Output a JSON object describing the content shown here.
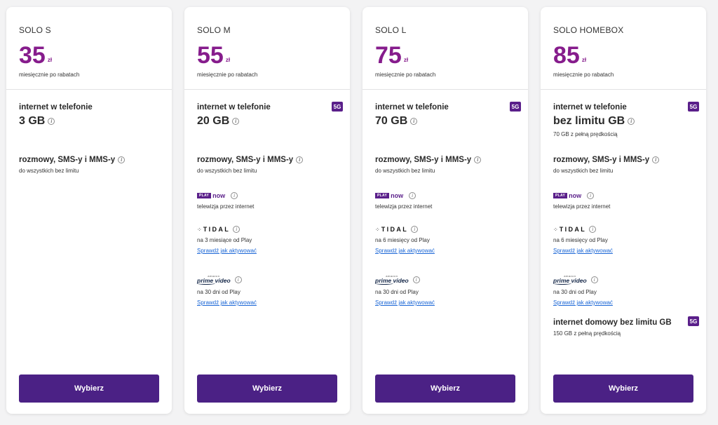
{
  "plans": [
    {
      "name": "SOLO S",
      "price": "35",
      "currency": "zł",
      "price_note": "miesięcznie po rabatach",
      "internet_title": "internet w telefonie",
      "internet_value": "3 GB",
      "calls_title": "rozmowy, SMS-y i MMS-y",
      "calls_note": "do wszystkich bez limitu",
      "button": "Wybierz"
    },
    {
      "name": "SOLO M",
      "price": "55",
      "currency": "zł",
      "price_note": "miesięcznie po rabatach",
      "internet_title": "internet w telefonie",
      "internet_value": "20 GB",
      "badge": "5G",
      "calls_title": "rozmowy, SMS-y i MMS-y",
      "calls_note": "do wszystkich bez limitu",
      "playnow_box": "PLAY",
      "playnow_word": "now",
      "playnow_note": "telewizja przez internet",
      "tidal_logo": "TIDAL",
      "tidal_note": "na 3 miesiące od Play",
      "tidal_link": "Sprawdź jak aktywować",
      "prime_top": "amazon",
      "prime_logo": "prime video",
      "prime_note": "na 30 dni od Play",
      "prime_link": "Sprawdź jak aktywować",
      "button": "Wybierz"
    },
    {
      "name": "SOLO L",
      "price": "75",
      "currency": "zł",
      "price_note": "miesięcznie po rabatach",
      "internet_title": "internet w telefonie",
      "internet_value": "70 GB",
      "badge": "5G",
      "calls_title": "rozmowy, SMS-y i MMS-y",
      "calls_note": "do wszystkich bez limitu",
      "playnow_box": "PLAY",
      "playnow_word": "now",
      "playnow_note": "telewizja przez internet",
      "tidal_logo": "TIDAL",
      "tidal_note": "na 6 miesięcy od Play",
      "tidal_link": "Sprawdź jak aktywować",
      "prime_top": "amazon",
      "prime_logo": "prime video",
      "prime_note": "na 30 dni od Play",
      "prime_link": "Sprawdź jak aktywować",
      "button": "Wybierz"
    },
    {
      "name": "SOLO HOMEBOX",
      "price": "85",
      "currency": "zł",
      "price_note": "miesięcznie po rabatach",
      "internet_title": "internet w telefonie",
      "internet_value": "bez limitu GB",
      "internet_note": "70 GB z pełną prędkością",
      "badge": "5G",
      "calls_title": "rozmowy, SMS-y i MMS-y",
      "calls_note": "do wszystkich bez limitu",
      "playnow_box": "PLAY",
      "playnow_word": "now",
      "playnow_note": "telewizja przez internet",
      "tidal_logo": "TIDAL",
      "tidal_note": "na 6 miesięcy od Play",
      "tidal_link": "Sprawdź jak aktywować",
      "prime_top": "amazon",
      "prime_logo": "prime video",
      "prime_note": "na 30 dni od Play",
      "prime_link": "Sprawdź jak aktywować",
      "home_title": "internet domowy bez limitu GB",
      "home_note": "150 GB z pełną prędkością",
      "home_badge": "5G",
      "button": "Wybierz"
    }
  ],
  "info_glyph": "i",
  "colors": {
    "price": "#861c8c",
    "button": "#4b2185",
    "badge": "#5a1f8a",
    "link": "#1a66d6"
  }
}
